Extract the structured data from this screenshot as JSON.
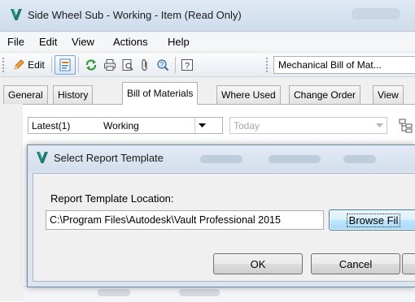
{
  "window": {
    "title": "Side Wheel Sub - Working - Item (Read Only)"
  },
  "menu": [
    "File",
    "Edit",
    "View",
    "Actions",
    "Help"
  ],
  "toolbar": {
    "edit_label": "Edit",
    "bom_view": "Mechanical Bill of Mat..."
  },
  "tabs": [
    {
      "label": "General",
      "active": false
    },
    {
      "label": "History",
      "active": false
    },
    {
      "label": "Bill of Materials",
      "active": true
    },
    {
      "label": "Where Used",
      "active": false
    },
    {
      "label": "Change Order",
      "active": false
    },
    {
      "label": "View",
      "active": false
    }
  ],
  "filters": {
    "version": "Latest(1)",
    "state": "Working",
    "date": "Today"
  },
  "dialog": {
    "title": "Select Report Template",
    "location_label": "Report Template Location:",
    "location_value": "C:\\Program Files\\Autodesk\\Vault Professional 2015",
    "browse_label": "Browse Fil",
    "ok_label": "OK",
    "cancel_label": "Cancel"
  },
  "colors": {
    "accent": "#3c7fb1",
    "logo": "#1d7a6e"
  }
}
